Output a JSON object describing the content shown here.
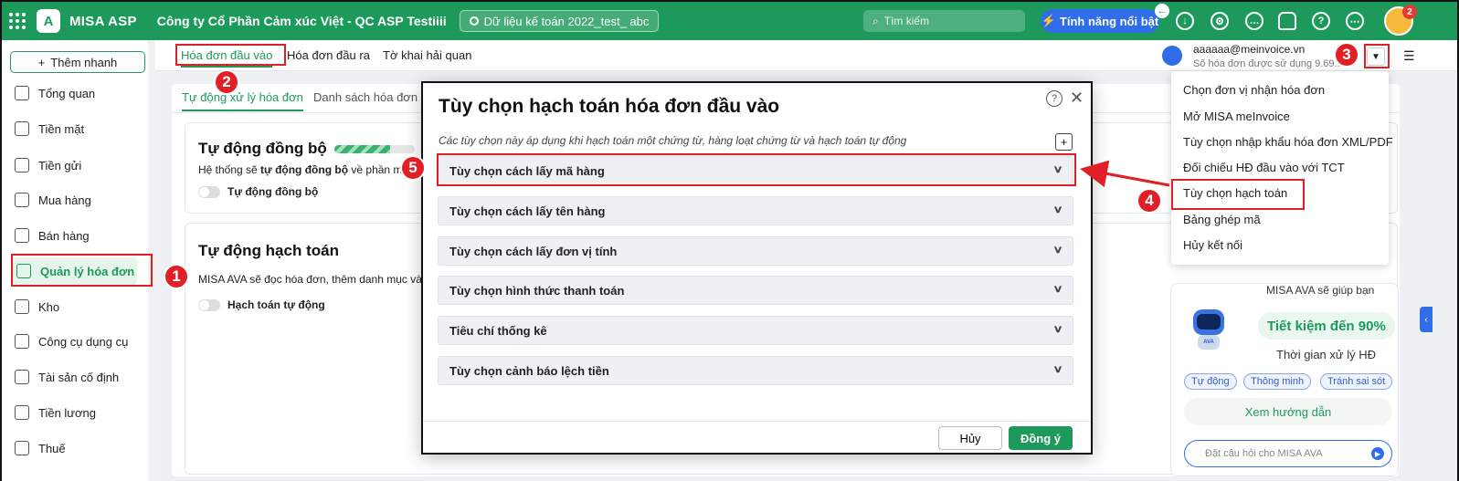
{
  "topbar": {
    "app_name": "MISA ASP",
    "company": "Công ty Cổ Phần Cảm xúc Việt - QC ASP Testiiii",
    "database": "Dữ liệu kế toán 2022_test_ abc",
    "search_placeholder": "Tìm kiếm",
    "feature_button": "Tính năng nổi bật",
    "notification_count": "2",
    "brand_color": "#1d9a5b"
  },
  "sidebar": {
    "quick_add": "Thêm nhanh",
    "items": [
      {
        "label": "Tổng quan",
        "icon": "dashboard-icon"
      },
      {
        "label": "Tiền mặt",
        "icon": "cash-icon"
      },
      {
        "label": "Tiền gửi",
        "icon": "bank-icon"
      },
      {
        "label": "Mua hàng",
        "icon": "shopping-bag-icon"
      },
      {
        "label": "Bán hàng",
        "icon": "cart-icon"
      },
      {
        "label": "Quản lý hóa đơn",
        "icon": "invoice-icon"
      },
      {
        "label": "Kho",
        "icon": "warehouse-icon"
      },
      {
        "label": "Công cụ dụng cụ",
        "icon": "tools-icon"
      },
      {
        "label": "Tài sản cố định",
        "icon": "truck-icon"
      },
      {
        "label": "Tiền lương",
        "icon": "payroll-icon"
      },
      {
        "label": "Thuế",
        "icon": "tax-icon"
      }
    ]
  },
  "subtabs": [
    "Hóa đơn đầu vào",
    "Hóa đơn đầu ra",
    "Tờ khai hải quan"
  ],
  "account": {
    "email": "aaaaaa@meinvoice.vn",
    "usage": "Số hóa đơn được sử dụng 9.69..."
  },
  "inner_tabs": [
    "Tự động xử lý hóa đơn",
    "Danh sách hóa đơn"
  ],
  "sync_block": {
    "title": "Tự động đồng bộ",
    "text_prefix": "Hệ thống sẽ ",
    "text_bold": "tự động đồng bộ",
    "text_suffix": " về phần m",
    "toggle_label": "Tự động đồng bộ",
    "progress": 0.7
  },
  "accounting_block": {
    "title": "Tự động hạch toán",
    "text": "MISA AVA sẽ đọc hóa đơn, thêm danh mục và",
    "toggle_label": "Hạch toán tự động"
  },
  "ava": {
    "cut_text": "MISA AVA sẽ giúp bạn",
    "save": "Tiết kiệm đến 90%",
    "time": "Thời gian xử lý HĐ",
    "chips": [
      "Tự động",
      "Thông minh",
      "Tránh sai sót"
    ],
    "guide": "Xem hướng dẫn",
    "input_placeholder": "Đặt câu hỏi cho MISA AVA",
    "robot_label": "AVA"
  },
  "dropdown": [
    "Chọn đơn vị nhận hóa đơn",
    "Mở MISA meInvoice",
    "Tùy chọn nhập khẩu hóa đơn XML/PDF",
    "Đối chiếu HĐ đầu vào với TCT",
    "Tùy chọn hạch toán",
    "Bảng ghép mã",
    "Hủy kết nối"
  ],
  "modal": {
    "title": "Tùy chọn hạch toán hóa đơn đầu vào",
    "description": "Các tùy chọn này áp dụng khi hạch toán một chứng từ, hàng loạt chứng từ và hạch toán tự động",
    "sections": [
      "Tùy chọn cách lấy mã hàng",
      "Tùy chọn cách lấy tên hàng",
      "Tùy chọn cách lấy đơn vị tính",
      "Tùy chọn hình thức thanh toán",
      "Tiêu chí thống kê",
      "Tùy chọn cảnh báo lệch tiền"
    ],
    "cancel": "Hủy",
    "ok": "Đồng ý"
  },
  "steps": [
    "1",
    "2",
    "3",
    "4",
    "5"
  ]
}
